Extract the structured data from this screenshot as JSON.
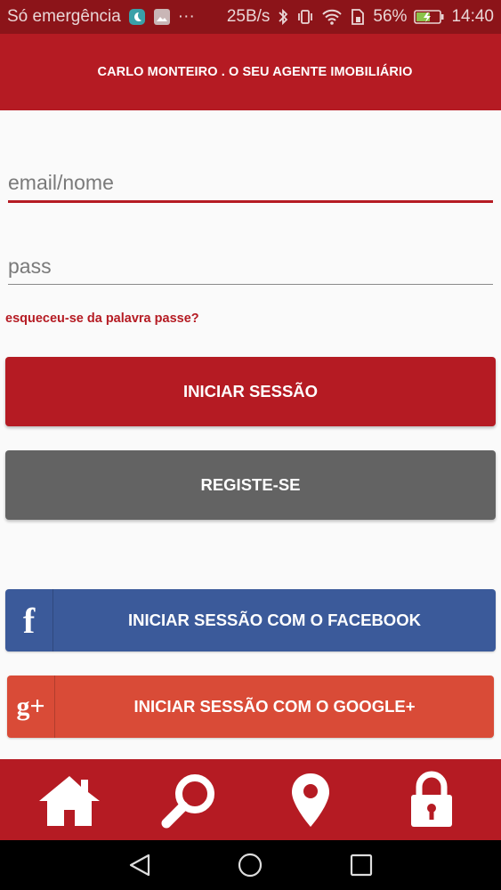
{
  "status_bar": {
    "carrier": "Só emergência",
    "net_speed": "25B/s",
    "battery": "56%",
    "time": "14:40",
    "ellipsis": "···"
  },
  "header": {
    "title": "CARLO MONTEIRO . O SEU AGENTE IMOBILIÁRIO"
  },
  "form": {
    "email_placeholder": "email/nome",
    "pass_placeholder": "pass",
    "forgot": "esqueceu-se da palavra passe?"
  },
  "buttons": {
    "login": "INICIAR SESSÃO",
    "register": "REGISTE-SE",
    "facebook": "INICIAR SESSÃO COM O FACEBOOK",
    "google": "INICIAR SESSÃO COM O GOOGLE+",
    "facebook_glyph": "f",
    "google_glyph": "g+"
  },
  "bottom_nav": {
    "items": [
      "home-icon",
      "search-icon",
      "map-pin-icon",
      "lock-icon"
    ]
  },
  "colors": {
    "primary": "#b51b23",
    "statusbar": "#8c1419",
    "register": "#636363",
    "facebook": "#3b5a9a",
    "google": "#d94b37"
  }
}
